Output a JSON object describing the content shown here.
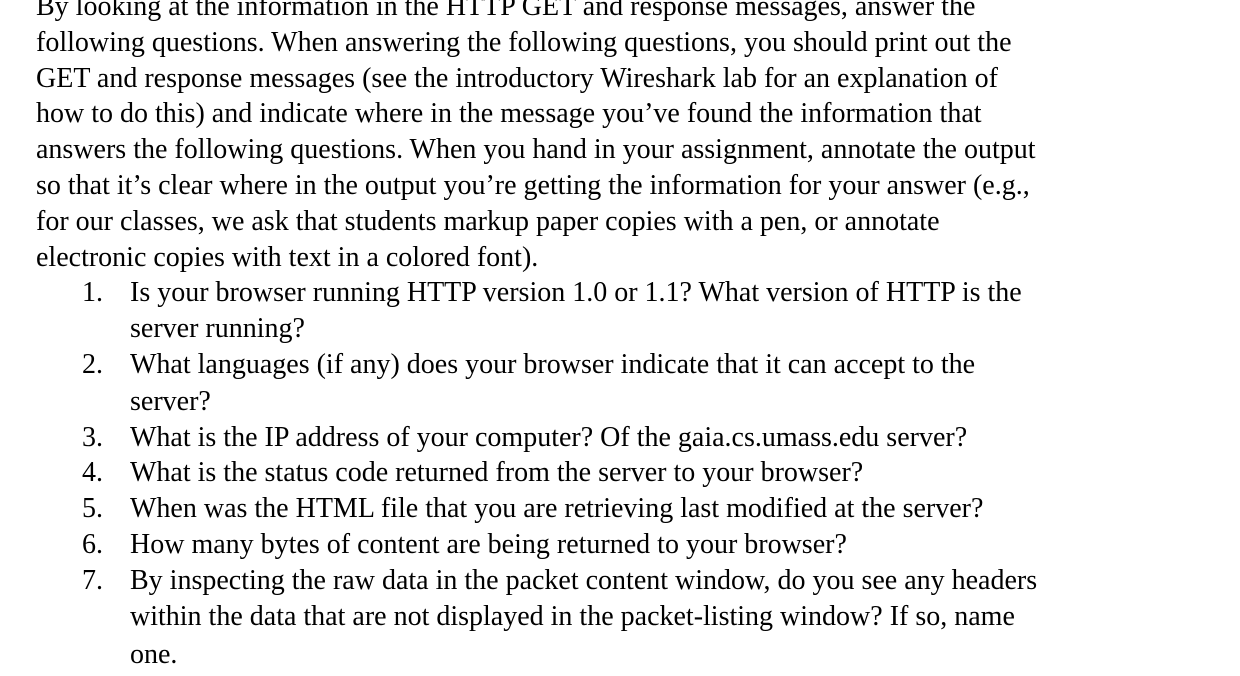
{
  "intro": {
    "lines": [
      "By looking at the information in the HTTP GET and response messages, answer the",
      "following questions.  When answering the following questions, you should print out the",
      "GET and response messages (see the introductory Wireshark lab for an explanation of",
      "how to do this) and indicate where in the message you’ve found the information that",
      "answers the following questions. When you hand in your assignment, annotate the output",
      "so that it’s clear where in the output you’re getting the information for your answer (e.g.,",
      "for our classes, we ask that students markup paper copies with a pen, or annotate",
      "electronic copies with text in a colored font)."
    ]
  },
  "questions": [
    {
      "number": "1.",
      "lines": [
        "Is your browser running HTTP version 1.0 or 1.1?  What version of HTTP is the",
        "server running?"
      ]
    },
    {
      "number": "2.",
      "lines": [
        "What languages (if any) does your browser indicate that it can accept to the",
        "server?"
      ]
    },
    {
      "number": "3.",
      "lines": [
        "What is the IP address of your computer?  Of the gaia.cs.umass.edu server?"
      ]
    },
    {
      "number": "4.",
      "lines": [
        "What is the status code returned from the server to your browser?"
      ]
    },
    {
      "number": "5.",
      "lines": [
        "When was the HTML file that you are retrieving last modified at the server?"
      ]
    },
    {
      "number": "6.",
      "lines": [
        "How many bytes of content are being returned to your browser?"
      ]
    },
    {
      "number": "7.",
      "lines": [
        "By inspecting the raw data in the packet content window, do you see any headers",
        "within the data that are not displayed in the packet-listing window?  If so, name",
        "one."
      ]
    }
  ]
}
